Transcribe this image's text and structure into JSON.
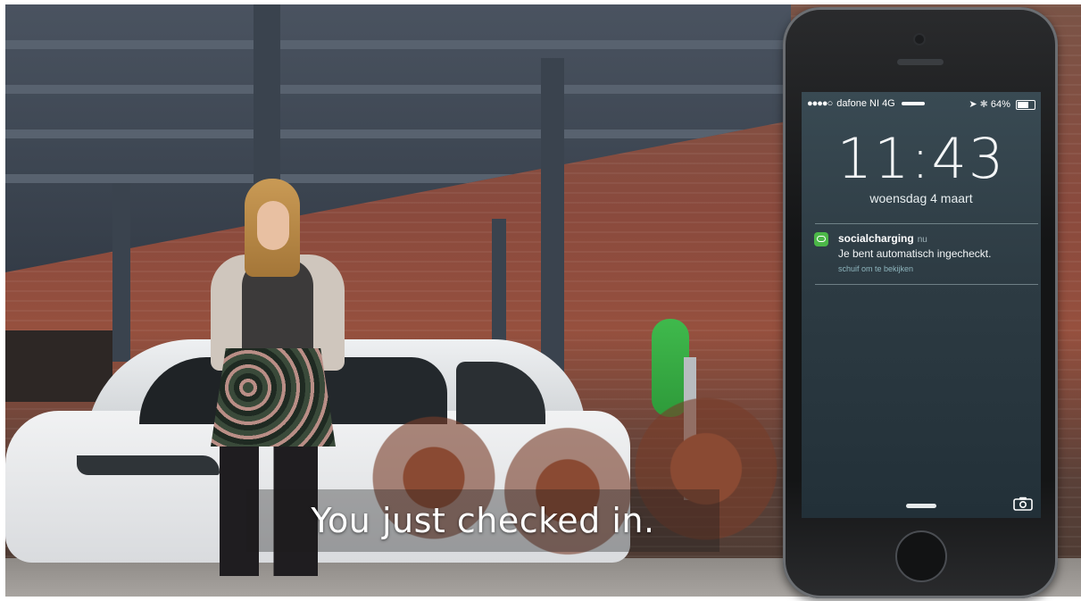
{
  "video": {
    "subtitle": "You just checked in."
  },
  "phone": {
    "status_bar": {
      "signal_dots": "●●●●○",
      "carrier": "dafone NI",
      "network": "4G",
      "battery": "64%",
      "battery_level": 0.64
    },
    "lock_screen": {
      "time": "11:43",
      "date": "woensdag 4 maart",
      "unlock_slider_icon": "slider-bar-icon",
      "camera_icon": "camera-icon"
    },
    "notification": {
      "app_icon": "chat-bubble-icon",
      "app_name": "socialcharging",
      "when": "nu",
      "message": "Je bent automatisch ingecheckt.",
      "hint": "schuif om te bekijken",
      "app_color": "#4cb848"
    }
  }
}
